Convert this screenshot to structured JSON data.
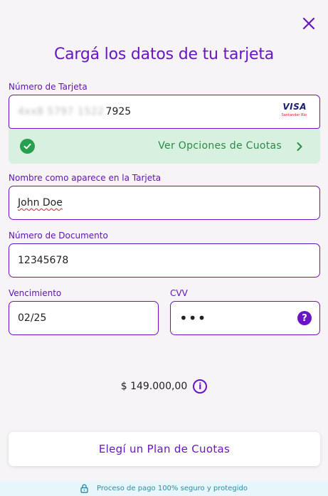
{
  "modal": {
    "title": "Cargá los datos de tu tarjeta",
    "close_icon": "close-icon"
  },
  "card_number": {
    "label": "Número de Tarjeta",
    "masked_prefix": "4xx8 5797 1522 ",
    "last_digits": "7925",
    "brand": "VISA",
    "bank": "Santander Rio"
  },
  "cuotas": {
    "label": "Ver Opciones de Cuotas",
    "status_icon": "check-circle-icon",
    "chevron_icon": "chevron-right-icon"
  },
  "name": {
    "label": "Nombre como aparece en la Tarjeta",
    "value": "John Doe"
  },
  "document": {
    "label": "Número de Documento",
    "value": "12345678"
  },
  "expiry": {
    "label": "Vencimiento",
    "value": "02/25"
  },
  "cvv": {
    "label": "CVV",
    "value": "•••",
    "help_icon": "question-icon"
  },
  "amount": {
    "value": "$ 149.000,00",
    "info_icon": "info-icon"
  },
  "plan_button": {
    "label": "Elegí un Plan de Cuotas"
  },
  "footer": {
    "text": "Proceso de pago 100% seguro y protegido",
    "icon": "lock-icon"
  },
  "colors": {
    "accent": "#6a14c7",
    "success": "#26a04e",
    "success_bg": "#d7f0df",
    "footer_bg": "#e7f6fb"
  }
}
